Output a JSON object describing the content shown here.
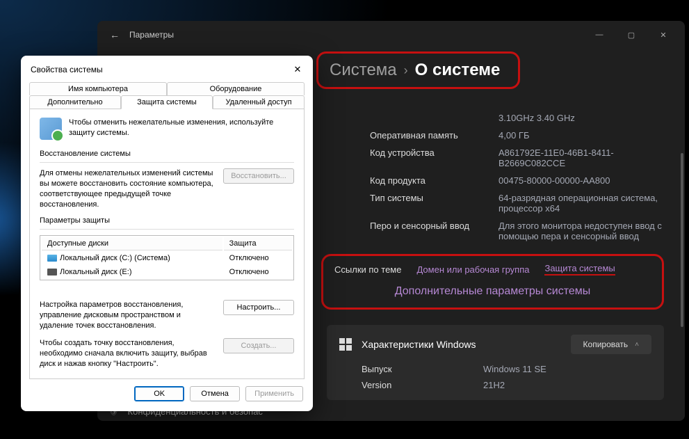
{
  "settings": {
    "app_title": "Параметры",
    "breadcrumb": {
      "parent": "Система",
      "current": "О системе"
    },
    "specs": {
      "cpu_freq": "3.10GHz   3.40 GHz",
      "ram_label": "Оперативная память",
      "ram_value": "4,00 ГБ",
      "device_id_label": "Код устройства",
      "device_id_value": "A861792E-11E0-46B1-8411-B2669C082CCE",
      "product_id_label": "Код продукта",
      "product_id_value": "00475-80000-00000-AA800",
      "system_type_label": "Тип системы",
      "system_type_value": "64-разрядная операционная система, процессор x64",
      "pen_label": "Перо и сенсорный ввод",
      "pen_value": "Для этого монитора недоступен ввод с помощью пера и сенсорный ввод"
    },
    "related": {
      "title": "Ссылки по теме",
      "domain": "Домен или рабочая группа",
      "protection": "Защита системы",
      "advanced": "Дополнительные параметры системы"
    },
    "windows_card": {
      "title": "Характеристики Windows",
      "copy": "Копировать",
      "edition_label": "Выпуск",
      "edition_value": "Windows 11 SE",
      "version_label": "Version",
      "version_value": "21H2"
    },
    "privacy_row": "Конфиденциальность и безопас"
  },
  "dialog": {
    "title": "Свойства системы",
    "tabs": {
      "computer_name": "Имя компьютера",
      "hardware": "Оборудование",
      "advanced": "Дополнительно",
      "protection": "Защита системы",
      "remote": "Удаленный доступ"
    },
    "intro": "Чтобы отменить нежелательные изменения, используйте защиту системы.",
    "restore": {
      "heading": "Восстановление системы",
      "desc": "Для отмены нежелательных изменений системы вы можете восстановить состояние компьютера, соответствующее предыдущей точке восстановления.",
      "button": "Восстановить..."
    },
    "params": {
      "heading": "Параметры защиты",
      "col_disk": "Доступные диски",
      "col_protection": "Защита",
      "disks": [
        {
          "name": "Локальный диск (C:) (Система)",
          "status": "Отключено",
          "icon": "c"
        },
        {
          "name": "Локальный диск (E:)",
          "status": "Отключено",
          "icon": "e"
        }
      ],
      "configure_desc": "Настройка параметров восстановления, управление дисковым пространством и удаление точек восстановления.",
      "configure_btn": "Настроить...",
      "create_desc": "Чтобы создать точку восстановления, необходимо сначала включить защиту, выбрав диск и нажав кнопку \"Настроить\".",
      "create_btn": "Создать..."
    },
    "footer": {
      "ok": "OK",
      "cancel": "Отмена",
      "apply": "Применить"
    }
  }
}
